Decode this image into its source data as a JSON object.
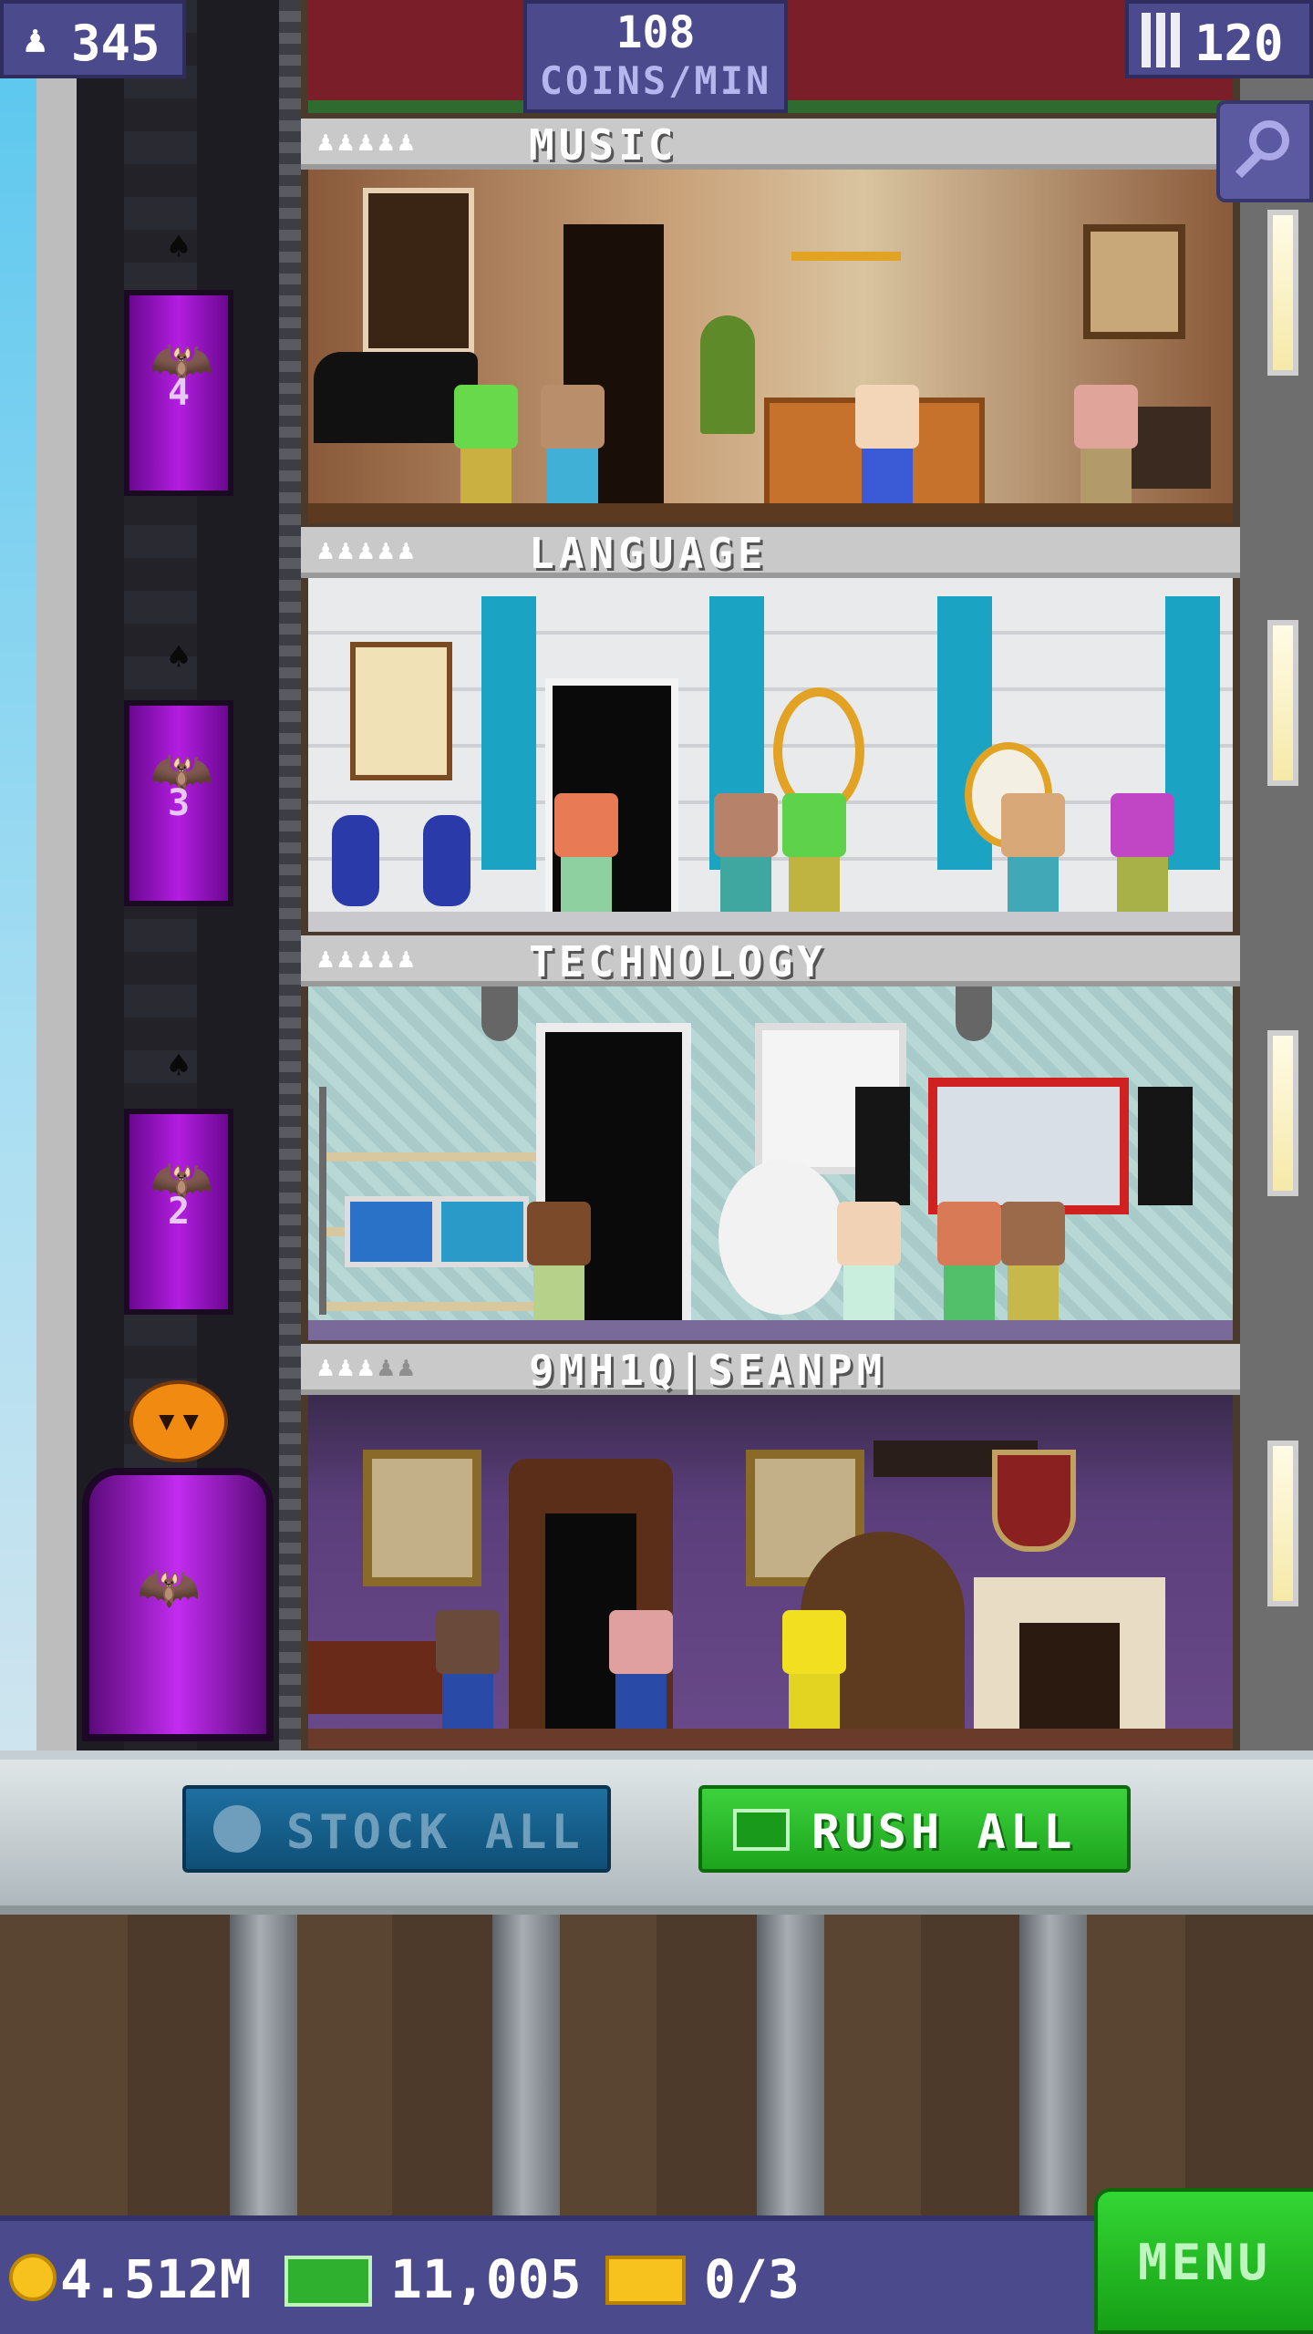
{
  "hud": {
    "population": "345",
    "coins_rate_value": "108",
    "coins_rate_unit": "COINS/MIN",
    "floor_count": "120"
  },
  "floors": [
    {
      "name": "MUSIC",
      "stars_filled": 5,
      "stars_total": 5
    },
    {
      "name": "LANGUAGE",
      "stars_filled": 5,
      "stars_total": 5
    },
    {
      "name": "TECHNOLOGY",
      "stars_filled": 5,
      "stars_total": 5
    },
    {
      "name": "9MH1Q|SEANPM",
      "stars_filled": 3,
      "stars_total": 5
    }
  ],
  "elevator": {
    "floor_numbers": [
      "4",
      "3",
      "2"
    ]
  },
  "actions": {
    "stock_all": "STOCK ALL",
    "rush_all": "RUSH ALL"
  },
  "bottom_bar": {
    "coins": "4.512M",
    "bux": "11,005",
    "tickets": "0/3",
    "menu": "MENU"
  },
  "colors": {
    "hud_panel": "#4b4a8c",
    "elevator_door": "#b31ee0",
    "rush_button": "#2bbd2b",
    "stock_button": "#1a6896"
  }
}
